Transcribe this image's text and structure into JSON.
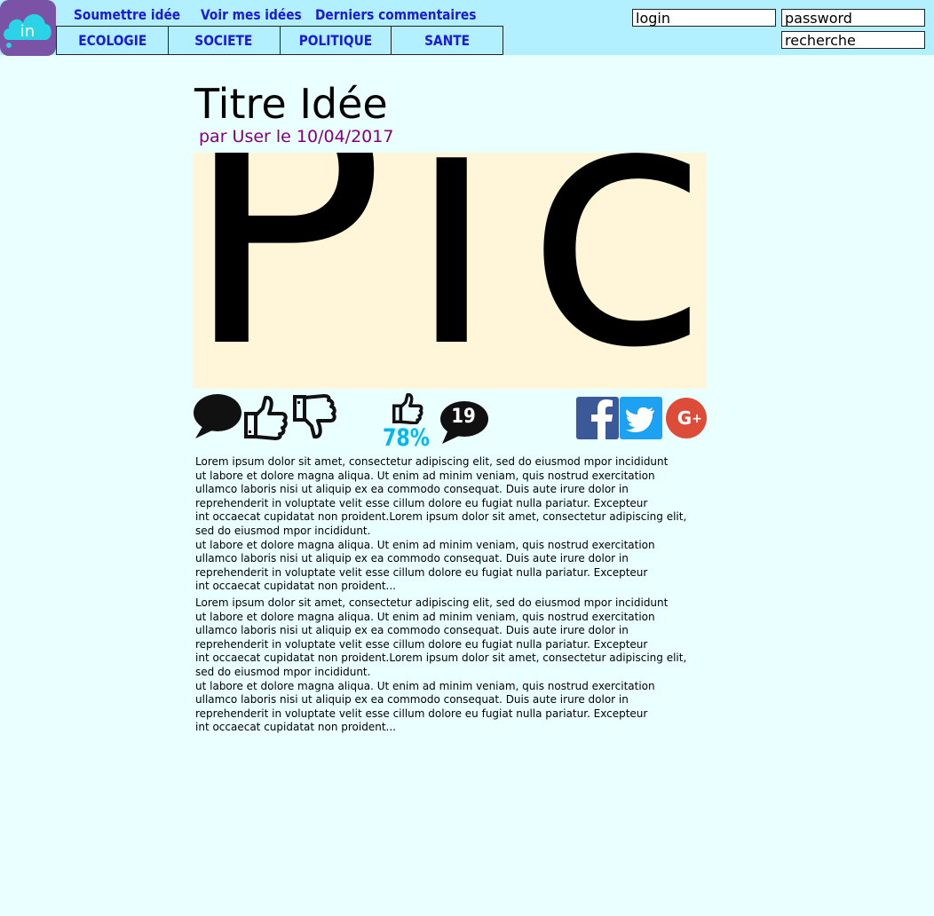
{
  "header": {
    "logo_text": "in",
    "nav": {
      "submit_label": "Soumettre idée",
      "my_ideas_label": "Voir mes idées",
      "comments_label": "Derniers commentaires"
    },
    "categories": [
      "ECOLOGIE",
      "SOCIETE",
      "POLITIQUE",
      "SANTE"
    ],
    "login_placeholder": "login",
    "password_placeholder": "password",
    "search_placeholder": "recherche"
  },
  "idea": {
    "title": "Titre Idée",
    "byline": "par User le 10/04/2017",
    "image_placeholder": "Pic",
    "approval": "78%",
    "comment_count": "19",
    "paragraphs": [
      "Lorem ipsum dolor sit amet, consectetur adipiscing elit, sed do eiusmod mpor incididunt\nut labore et dolore magna aliqua. Ut enim ad minim veniam, quis nostrud exercitation\nullamco laboris nisi ut aliquip ex ea commodo consequat. Duis aute irure dolor in\nreprehenderit in voluptate velit esse cillum dolore eu fugiat nulla pariatur. Excepteur\nint occaecat cupidatat non proident.Lorem ipsum dolor sit amet, consectetur adipiscing elit,\nsed do eiusmod mpor incididunt.\nut labore et dolore magna aliqua. Ut enim ad minim veniam, quis nostrud exercitation\nullamco laboris nisi ut aliquip ex ea commodo consequat. Duis aute irure dolor in\nreprehenderit in voluptate velit esse cillum dolore eu fugiat nulla pariatur. Excepteur\nint occaecat cupidatat non proident...",
      "Lorem ipsum dolor sit amet, consectetur adipiscing elit, sed do eiusmod mpor incididunt\nut labore et dolore magna aliqua. Ut enim ad minim veniam, quis nostrud exercitation\nullamco laboris nisi ut aliquip ex ea commodo consequat. Duis aute irure dolor in\nreprehenderit in voluptate velit esse cillum dolore eu fugiat nulla pariatur. Excepteur\nint occaecat cupidatat non proident.Lorem ipsum dolor sit amet, consectetur adipiscing elit,\nsed do eiusmod mpor incididunt.\nut labore et dolore magna aliqua. Ut enim ad minim veniam, quis nostrud exercitation\nullamco laboris nisi ut aliquip ex ea commodo consequat. Duis aute irure dolor in\nreprehenderit in voluptate velit esse cillum dolore eu fugiat nulla pariatur. Excepteur\nint occaecat cupidatat non proident..."
    ]
  },
  "icons": {
    "comment": "comment-bubble-icon",
    "like": "thumbs-up-icon",
    "dislike": "thumbs-down-icon",
    "score": "thumbs-up-small-icon",
    "comments_count": "comment-count-icon",
    "facebook": "facebook-icon",
    "twitter": "twitter-icon",
    "google_plus": "google-plus-icon"
  },
  "colors": {
    "page_bg": "#eaffff",
    "topbar_bg": "#b2efff",
    "nav_link": "#1a1adb",
    "byline": "#800080",
    "approval": "#00b7ee",
    "logo_bg": "#7b53a6",
    "image_bg": "#fff5d8",
    "facebook": "#3b5998",
    "twitter": "#1da1f2",
    "google_plus": "#dd4b39"
  }
}
